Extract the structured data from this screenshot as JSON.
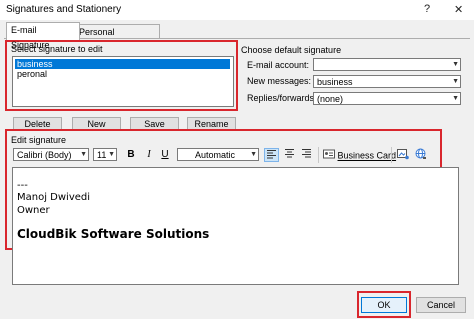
{
  "window": {
    "title": "Signatures and Stationery",
    "help": "?",
    "close": "✕"
  },
  "tabs": [
    {
      "label": "E-mail Signature"
    },
    {
      "label": "Personal Stationery"
    }
  ],
  "select_signature": {
    "label": "Select signature to edit",
    "items": [
      "business",
      "peronal"
    ],
    "selected": "business"
  },
  "sig_buttons": {
    "delete": "Delete",
    "new": "New",
    "save": "Save",
    "rename": "Rename"
  },
  "default_signature": {
    "label": "Choose default signature",
    "email_account_label": "E-mail account:",
    "email_account_value": "",
    "new_messages_label": "New messages:",
    "new_messages_value": "business",
    "replies_label": "Replies/forwards:",
    "replies_value": "(none)"
  },
  "edit_signature": {
    "label": "Edit signature",
    "font": "Calibri (Body)",
    "size": "11",
    "bold": "B",
    "italic": "I",
    "underline": "U",
    "color": "Automatic",
    "business_card": "Business Card",
    "lines": [
      "---",
      "Manoj Dwivedi",
      "Owner",
      "CloudBik Software Solutions"
    ]
  },
  "footer": {
    "ok": "OK",
    "cancel": "Cancel"
  },
  "colors": {
    "highlight": "#d9262d",
    "selection": "#0078d7",
    "window_bg": "#f0f0f0"
  }
}
